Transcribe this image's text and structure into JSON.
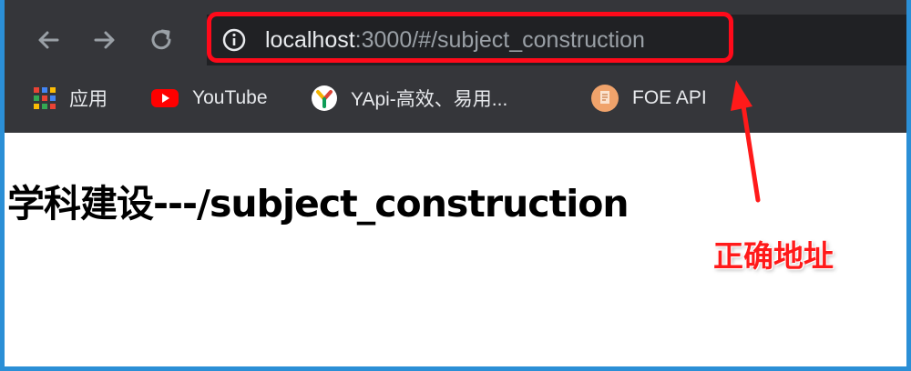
{
  "browser": {
    "url_host": "localhost",
    "url_rest": ":3000/#/subject_construction"
  },
  "bookmarks": [
    {
      "label": "应用",
      "icon": "apps-grid-icon"
    },
    {
      "label": "YouTube",
      "icon": "youtube-icon"
    },
    {
      "label": "YApi-高效、易用...",
      "icon": "yapi-icon"
    },
    {
      "label": "FOE API",
      "icon": "document-icon"
    }
  ],
  "page": {
    "heading": "学科建设---/subject_construction"
  },
  "annotation": {
    "label": "正确地址",
    "color": "#ff1a1a"
  },
  "colors": {
    "toolbar": "#35363a",
    "highlight": "#ff0a1a"
  }
}
